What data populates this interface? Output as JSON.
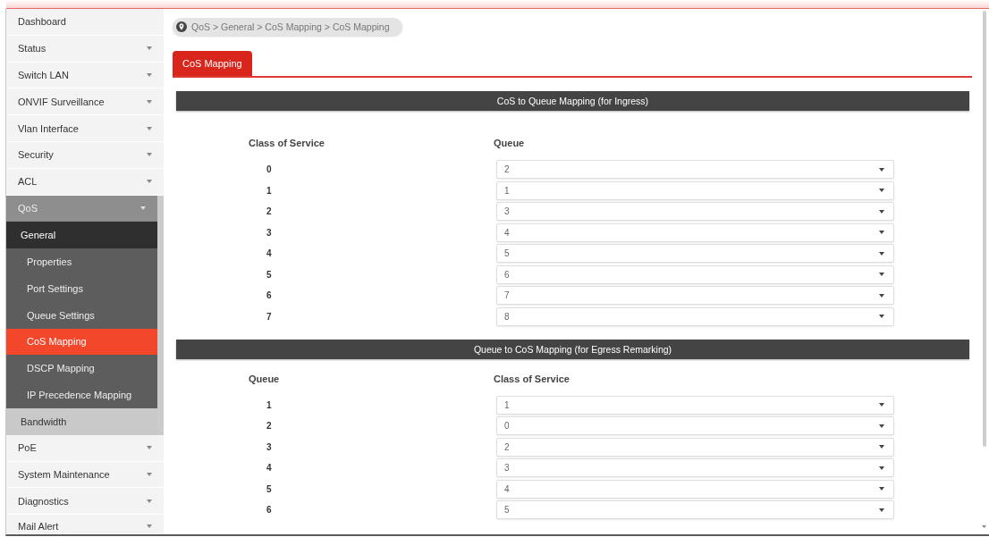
{
  "sidebar": {
    "items": [
      {
        "label": "Dashboard",
        "kind": "link",
        "selected": false
      },
      {
        "label": "Status",
        "kind": "group",
        "expanded": false
      },
      {
        "label": "Switch LAN",
        "kind": "group",
        "expanded": false
      },
      {
        "label": "ONVIF Surveillance",
        "kind": "group",
        "expanded": false
      },
      {
        "label": "Vlan Interface",
        "kind": "group",
        "expanded": false
      },
      {
        "label": "Security",
        "kind": "group",
        "expanded": false
      },
      {
        "label": "ACL",
        "kind": "group",
        "expanded": false
      },
      {
        "label": "QoS",
        "kind": "group",
        "expanded": true,
        "children": [
          {
            "label": "General",
            "kind": "group",
            "expanded": true,
            "children": [
              {
                "label": "Properties",
                "kind": "link",
                "selected": false
              },
              {
                "label": "Port Settings",
                "kind": "link",
                "selected": false
              },
              {
                "label": "Queue Settings",
                "kind": "link",
                "selected": false
              },
              {
                "label": "CoS Mapping",
                "kind": "link",
                "selected": true
              },
              {
                "label": "DSCP Mapping",
                "kind": "link",
                "selected": false
              },
              {
                "label": "IP Precedence Mapping",
                "kind": "link",
                "selected": false
              }
            ]
          },
          {
            "label": "Bandwidth",
            "kind": "group",
            "expanded": false
          }
        ]
      },
      {
        "label": "PoE",
        "kind": "group",
        "expanded": false
      },
      {
        "label": "System Maintenance",
        "kind": "group",
        "expanded": false
      },
      {
        "label": "Diagnostics",
        "kind": "group",
        "expanded": false
      },
      {
        "label": "Mail Alert",
        "kind": "group",
        "expanded": false
      }
    ]
  },
  "breadcrumb": {
    "text": "QoS > General > CoS Mapping > CoS Mapping"
  },
  "tabs": [
    {
      "label": "CoS Mapping",
      "selected": true
    }
  ],
  "sections": [
    {
      "title": "CoS to Queue Mapping (for Ingress)",
      "columns": [
        "Class of Service",
        "Queue"
      ],
      "rows": [
        {
          "key": "0",
          "value": "2"
        },
        {
          "key": "1",
          "value": "1"
        },
        {
          "key": "2",
          "value": "3"
        },
        {
          "key": "3",
          "value": "4"
        },
        {
          "key": "4",
          "value": "5"
        },
        {
          "key": "5",
          "value": "6"
        },
        {
          "key": "6",
          "value": "7"
        },
        {
          "key": "7",
          "value": "8"
        }
      ]
    },
    {
      "title": "Queue to CoS Mapping (for Egress Remarking)",
      "columns": [
        "Queue",
        "Class of Service"
      ],
      "rows": [
        {
          "key": "1",
          "value": "1"
        },
        {
          "key": "2",
          "value": "0"
        },
        {
          "key": "3",
          "value": "2"
        },
        {
          "key": "4",
          "value": "3"
        },
        {
          "key": "5",
          "value": "4"
        },
        {
          "key": "6",
          "value": "5"
        }
      ]
    }
  ]
}
